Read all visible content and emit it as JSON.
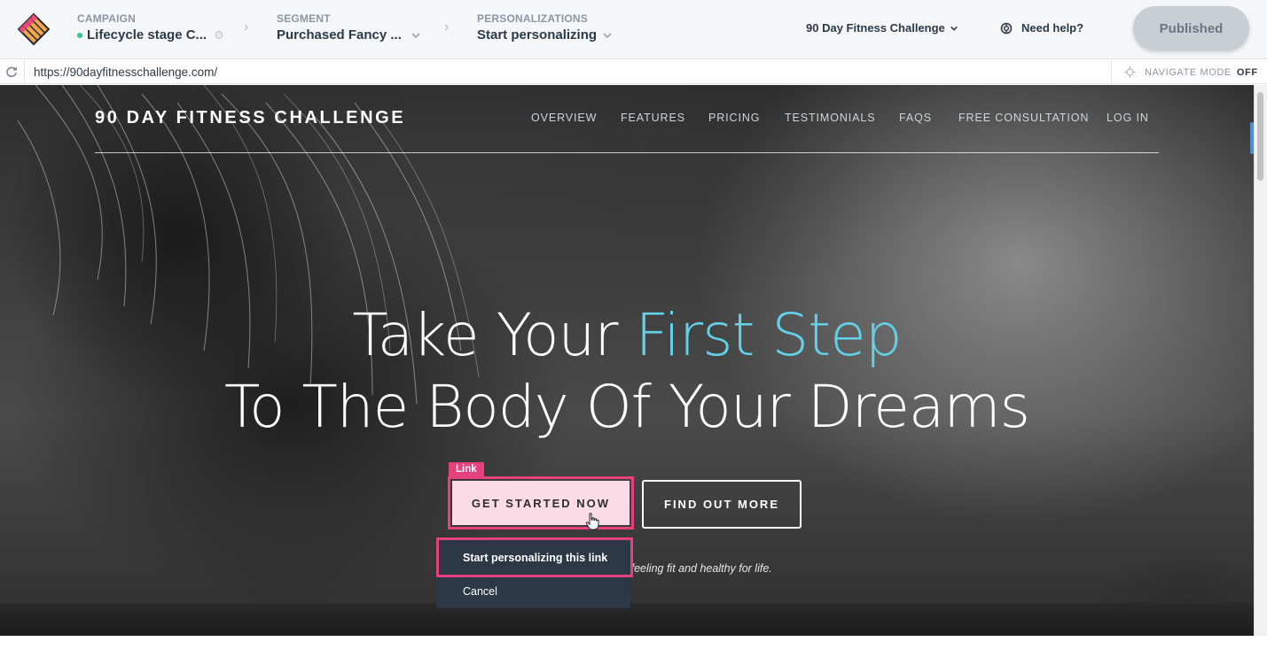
{
  "header": {
    "campaign": {
      "label": "CAMPAIGN",
      "value": "Lifecycle stage C..."
    },
    "segment": {
      "label": "SEGMENT",
      "value": "Purchased Fancy ..."
    },
    "personalizations": {
      "label": "PERSONALIZATIONS",
      "value": "Start personalizing"
    },
    "site_selector": "90 Day Fitness Challenge",
    "help": "Need help?",
    "publish_status": "Published"
  },
  "urlbar": {
    "url": "https://90dayfitnesschallenge.com/",
    "navigate_mode_label": "NAVIGATE MODE",
    "navigate_mode_state": "OFF"
  },
  "site": {
    "brand": "90 DAY FITNESS CHALLENGE",
    "nav": [
      "OVERVIEW",
      "FEATURES",
      "PRICING",
      "TESTIMONIALS",
      "FAQS",
      "FREE CONSULTATION",
      "LOG IN"
    ],
    "hero": {
      "line1_prefix": "Take Your ",
      "line1_accent": "First Step",
      "line2": "To The Body Of Your Dreams"
    },
    "cta_primary": "GET STARTED NOW",
    "cta_secondary": "FIND OUT MORE",
    "tagline_fragment": "r feeling fit and healthy for life."
  },
  "editor": {
    "element_tag": "Link",
    "context_menu": [
      "Start personalizing this link",
      "Cancel"
    ]
  },
  "colors": {
    "highlight": "#e7417d",
    "accent_text": "#63d1e8",
    "status_live": "#3cc48a",
    "menu_bg": "#2c3845"
  },
  "icons": [
    "app-logo-icon",
    "gear-icon",
    "chevron-right-icon",
    "chevron-down-icon",
    "lifebuoy-icon",
    "refresh-icon",
    "crosshair-icon",
    "hand-cursor-icon"
  ]
}
